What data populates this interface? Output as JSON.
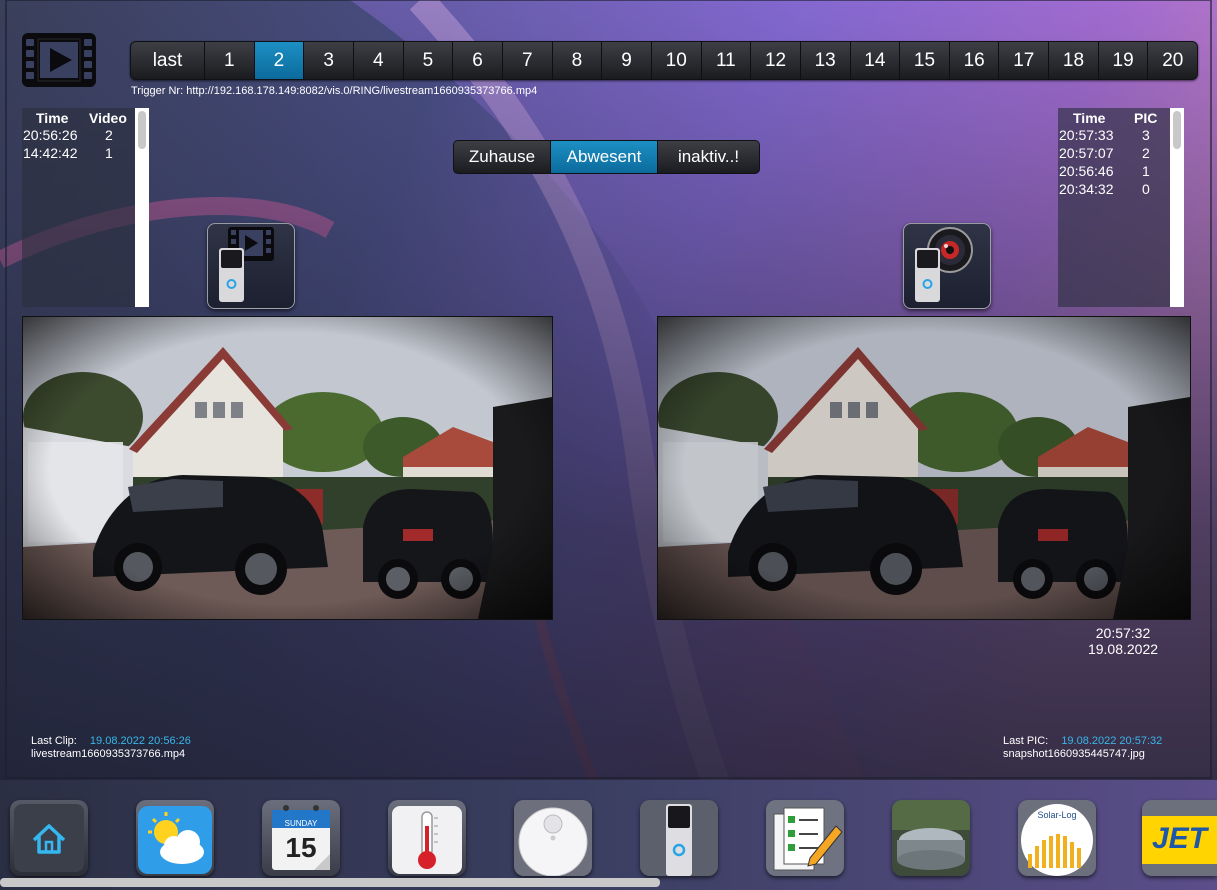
{
  "pages": {
    "items": [
      "last",
      "1",
      "2",
      "3",
      "4",
      "5",
      "6",
      "7",
      "8",
      "9",
      "10",
      "11",
      "12",
      "13",
      "14",
      "15",
      "16",
      "17",
      "18",
      "19",
      "20"
    ],
    "selected_index": 2
  },
  "trigger": "Trigger Nr: http://192.168.178.149:8082/vis.0/RING/livestream1660935373766.mp4",
  "video_log": {
    "headers": {
      "time": "Time",
      "count": "Video"
    },
    "rows": [
      {
        "time": "20:56:26",
        "count": "2"
      },
      {
        "time": "14:42:42",
        "count": "1"
      }
    ]
  },
  "pic_log": {
    "headers": {
      "time": "Time",
      "count": "PIC"
    },
    "rows": [
      {
        "time": "20:57:33",
        "count": "3"
      },
      {
        "time": "20:57:07",
        "count": "2"
      },
      {
        "time": "20:56:46",
        "count": "1"
      },
      {
        "time": "20:34:32",
        "count": "0"
      }
    ]
  },
  "mode": {
    "items": [
      "Zuhause",
      "Abwesent",
      "inaktiv..!"
    ],
    "selected_index": 1
  },
  "snapshot": {
    "time": "20:57:32",
    "date": "19.08.2022"
  },
  "last_clip": {
    "label": "Last Clip:",
    "datetime": "19.08.2022 20:56:26",
    "file": "livestream1660935373766.mp4"
  },
  "last_pic": {
    "label": "Last PIC:",
    "datetime": "19.08.2022 20:57:32",
    "file": "snapshot1660935445747.jpg"
  },
  "calendar": {
    "day_name": "SUNDAY",
    "day": "15"
  },
  "solar": {
    "label": "Solar-Log"
  },
  "jet": {
    "label": "JET"
  },
  "colors": {
    "accent": "#1d8fc4",
    "highlight_text": "#3ab6e8"
  }
}
